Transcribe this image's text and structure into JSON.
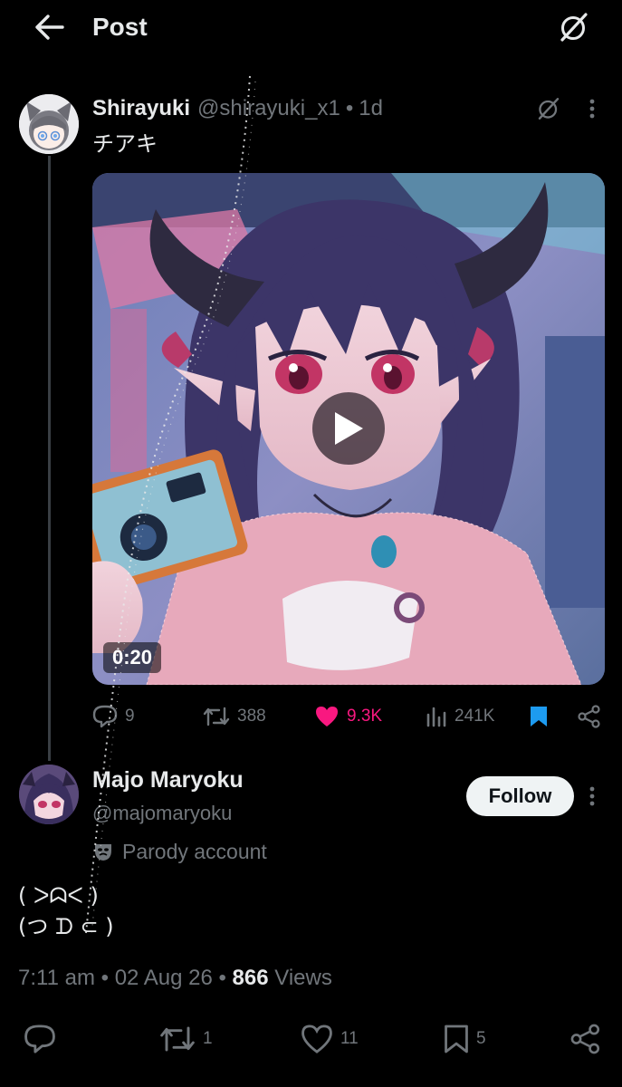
{
  "header": {
    "title": "Post"
  },
  "post": {
    "author_name": "Shirayuki",
    "author_handle": "@shirayuki_x1",
    "separator": "•",
    "time": "1d",
    "text": "チアキ",
    "video_duration": "0:20",
    "stats": {
      "replies": "9",
      "reposts": "388",
      "likes": "9.3K",
      "views": "241K"
    },
    "liked": true,
    "bookmarked": true
  },
  "reply": {
    "author_name": "Majo Maryoku",
    "author_handle": "@majomaryoku",
    "follow_label": "Follow",
    "badge": "Parody account",
    "body_line1": "( ᐳᗣᐸ )",
    "body_line2": "(つ ᗪ ⊂ )",
    "time": "7:11 am",
    "date": "02 Aug 26",
    "separator": "•",
    "views_count": "866",
    "views_label": "Views",
    "stats": {
      "reposts": "1",
      "likes": "11",
      "bookmarks": "5"
    }
  },
  "colors": {
    "background": "#000000",
    "text": "#e7e9ea",
    "muted": "#71767b",
    "like": "#f91880",
    "bookmark": "#1d9bf0",
    "follow_bg": "#eff3f4"
  },
  "icons": [
    "back-arrow-icon",
    "grok-icon",
    "more-icon",
    "play-icon",
    "reply-icon",
    "repost-icon",
    "heart-icon",
    "analytics-icon",
    "bookmark-icon",
    "share-icon",
    "mask-icon"
  ]
}
